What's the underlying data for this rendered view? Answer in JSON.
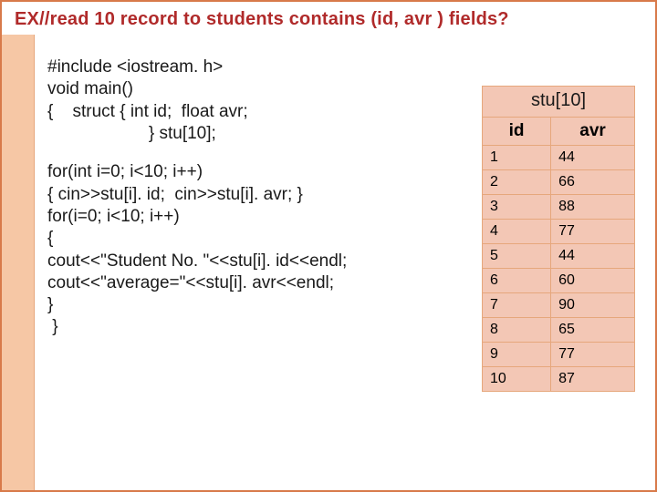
{
  "title": "EX//read 10 record to students contains (id, avr ) fields?",
  "code": {
    "block1_l1": "#include <iostream. h>",
    "block1_l2": "void main()",
    "block1_l3": "{    struct { int id;  float avr;",
    "block1_l4": "                     } stu[10];",
    "block2_l1": "for(int i=0; i<10; i++)",
    "block2_l2": "{ cin>>stu[i]. id;  cin>>stu[i]. avr; }",
    "block2_l3": "for(i=0; i<10; i++)",
    "block2_l4": "{",
    "block2_l5": "cout<<\"Student No. \"<<stu[i]. id<<endl;",
    "block2_l6": "cout<<\"average=\"<<stu[i]. avr<<endl;",
    "block2_l7": "}",
    "block2_l8": " }"
  },
  "table": {
    "caption": "stu[10]",
    "headers": {
      "id": "id",
      "avr": "avr"
    },
    "rows": [
      {
        "id": "1",
        "avr": "44"
      },
      {
        "id": "2",
        "avr": "66"
      },
      {
        "id": "3",
        "avr": "88"
      },
      {
        "id": "4",
        "avr": "77"
      },
      {
        "id": "5",
        "avr": "44"
      },
      {
        "id": "6",
        "avr": "60"
      },
      {
        "id": "7",
        "avr": "90"
      },
      {
        "id": "8",
        "avr": "65"
      },
      {
        "id": "9",
        "avr": "77"
      },
      {
        "id": "10",
        "avr": "87"
      }
    ]
  }
}
